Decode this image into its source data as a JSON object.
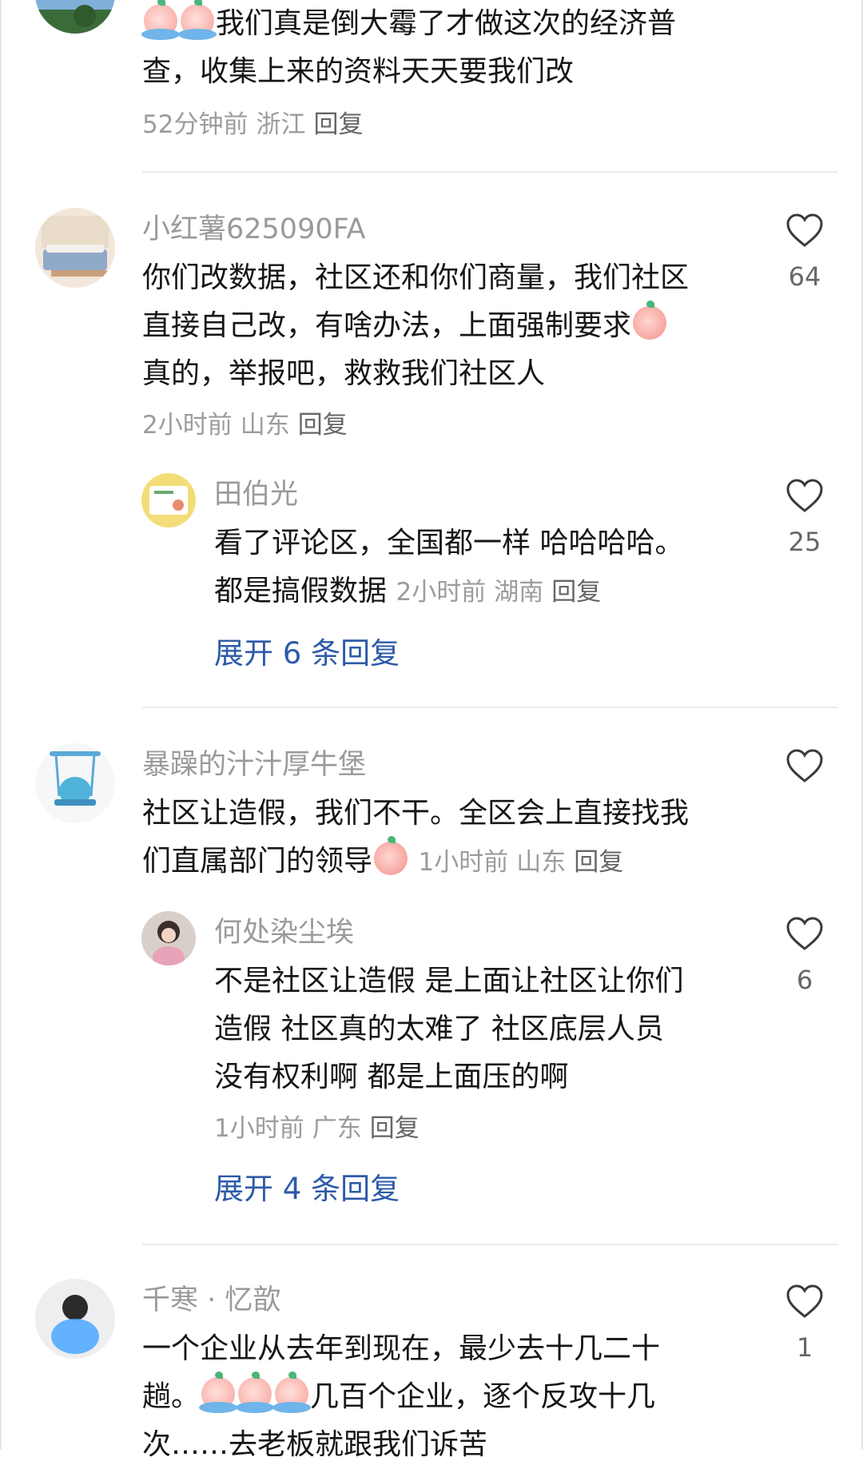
{
  "comments": [
    {
      "text_lines": [
        "我们真是倒大霉了才做这次的经济普",
        "查，收集上来的资料天天要我们改"
      ],
      "time": "52分钟前",
      "region": "浙江",
      "reply_label": "回复"
    },
    {
      "username": "小红薯625090FA",
      "text_lines": [
        "你们改数据，社区还和你们商量，我们社区",
        "直接自己改，有啥办法，上面强制要求",
        "真的，举报吧，救救我们社区人"
      ],
      "time": "2小时前",
      "region": "山东",
      "reply_label": "回复",
      "likes": "64",
      "reply": {
        "username": "田伯光",
        "text_lines": [
          "看了评论区，全国都一样 哈哈哈哈。",
          "都是搞假数据"
        ],
        "time": "2小时前",
        "region": "湖南",
        "reply_label": "回复",
        "likes": "25"
      },
      "expand_label": "展开 6 条回复"
    },
    {
      "username": "暴躁的汁汁厚牛堡",
      "text_lines": [
        "社区让造假，我们不干。全区会上直接找我",
        "们直属部门的领导"
      ],
      "time": "1小时前",
      "region": "山东",
      "reply_label": "回复",
      "reply": {
        "username": "何处染尘埃",
        "text_lines": [
          "不是社区让造假 是上面让社区让你们",
          "造假 社区真的太难了 社区底层人员",
          "没有权利啊 都是上面压的啊"
        ],
        "time": "1小时前",
        "region": "广东",
        "reply_label": "回复",
        "likes": "6"
      },
      "expand_label": "展开 4 条回复"
    },
    {
      "username": "千寒 · 忆歆",
      "text_lines": [
        "一个企业从去年到现在，最少去十几二十",
        "趟。几百个企业，逐个反攻十几",
        "次……去老板就跟我们诉苦"
      ],
      "likes": "1"
    }
  ],
  "colors": {
    "username": "#9a9a9a",
    "text": "#161616",
    "meta": "#9c9c9c",
    "expand_link": "#2e5aa8",
    "divider": "#ececec"
  },
  "icons": {
    "like": "heart-outline-icon",
    "emoji_crying": "crying-face-emoji",
    "emoji_blush": "blushing-face-emoji"
  }
}
